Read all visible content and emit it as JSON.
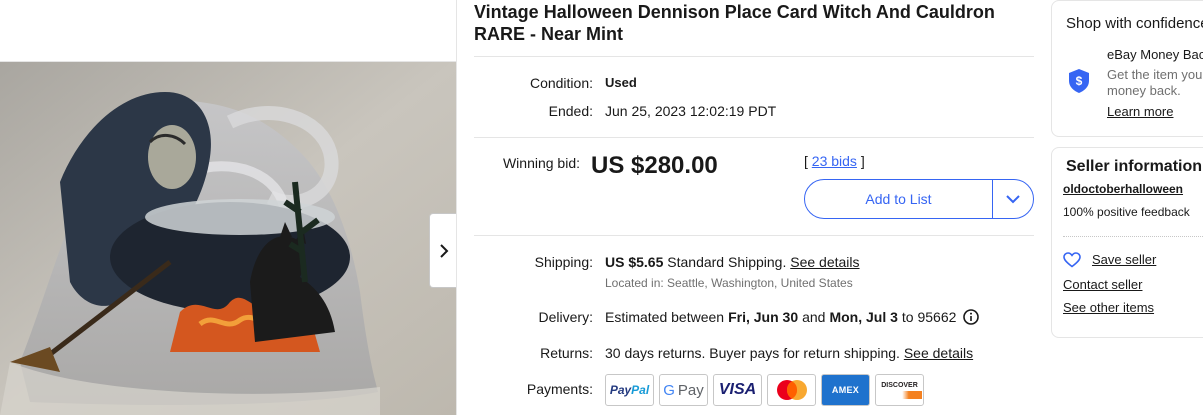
{
  "item": {
    "title": "Vintage Halloween Dennison Place Card Witch And Cauldron RARE - Near Mint"
  },
  "details": {
    "condition_label": "Condition:",
    "condition_value": "Used",
    "ended_label": "Ended:",
    "ended_value": "Jun 25, 2023 12:02:19 PDT",
    "winning_label": "Winning bid:",
    "winning_price": "US $280.00",
    "bids_open": "[",
    "bids_link": "23 bids",
    "bids_close": "]",
    "add_to_list": "Add to List",
    "shipping_label": "Shipping:",
    "shipping_price": "US $5.65",
    "shipping_method": "Standard Shipping.",
    "shipping_link": "See details",
    "shipping_location": "Located in: Seattle, Washington, United States",
    "delivery_label": "Delivery:",
    "delivery_prefix": "Estimated between",
    "delivery_start": "Fri, Jun 30",
    "delivery_and": "and",
    "delivery_end": "Mon, Jul 3",
    "delivery_to": "to 95662",
    "returns_label": "Returns:",
    "returns_text": "30 days returns. Buyer pays for return shipping.",
    "returns_link": "See details",
    "payments_label": "Payments:",
    "payment_methods": [
      "PayPal",
      "G Pay",
      "VISA",
      "Mastercard",
      "AMEX",
      "DISCOVER"
    ]
  },
  "shop_card": {
    "title": "Shop with confidence",
    "guarantee_title": "eBay Money Back Guarantee",
    "guarantee_desc_1": "Get the item you ordered or get your",
    "guarantee_desc_2": "money back.",
    "learn_more": "Learn more"
  },
  "seller_card": {
    "title": "Seller information",
    "username": "oldoctoberhalloween",
    "feedback": "100% positive feedback",
    "save_seller": "Save seller",
    "contact_seller": "Contact seller",
    "see_other": "See other items"
  },
  "colors": {
    "ebay_blue": "#3665f3",
    "text": "#191919",
    "muted": "#707070",
    "divider": "#e5e5e5"
  }
}
